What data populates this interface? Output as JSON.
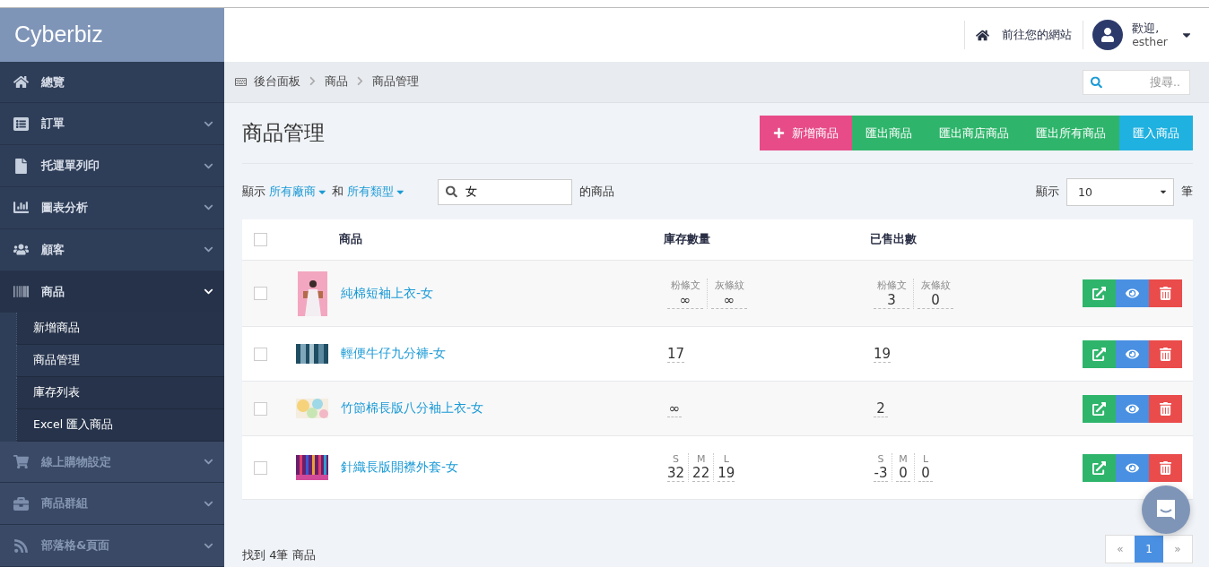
{
  "brand": {
    "logo": "Cyberbiz"
  },
  "topbar": {
    "site_link": "前往您的網站",
    "greeting": "歡迎,",
    "user": "esther"
  },
  "sidebar": {
    "items": [
      {
        "label": "總覽",
        "kind": "link",
        "expanded": false,
        "disabled": false
      },
      {
        "label": "訂單",
        "kind": "menu",
        "expanded": false,
        "disabled": false
      },
      {
        "label": "托運單列印",
        "kind": "menu",
        "expanded": false,
        "disabled": false
      },
      {
        "label": "圖表分析",
        "kind": "menu",
        "expanded": false,
        "disabled": false
      },
      {
        "label": "顧客",
        "kind": "menu",
        "expanded": false,
        "disabled": false
      },
      {
        "label": "商品",
        "kind": "menu",
        "expanded": true,
        "disabled": false,
        "children": [
          {
            "label": "新增商品",
            "selected": false
          },
          {
            "label": "商品管理",
            "selected": true
          },
          {
            "label": "庫存列表",
            "selected": false
          },
          {
            "label": "Excel 匯入商品",
            "selected": false
          }
        ]
      },
      {
        "label": "線上購物設定",
        "kind": "menu",
        "expanded": false,
        "disabled": true
      },
      {
        "label": "商品群組",
        "kind": "menu",
        "expanded": false,
        "disabled": true
      },
      {
        "label": "部落格&頁面",
        "kind": "menu",
        "expanded": false,
        "disabled": true
      }
    ]
  },
  "breadcrumb": [
    "後台面板",
    "商品",
    "商品管理"
  ],
  "search": {
    "placeholder": "搜尋.."
  },
  "page_title": "商品管理",
  "actions": [
    {
      "label": "新增商品",
      "kind": "add"
    },
    {
      "label": "匯出商品",
      "kind": "export"
    },
    {
      "label": "匯出商店商品",
      "kind": "export"
    },
    {
      "label": "匯出所有商品",
      "kind": "export"
    },
    {
      "label": "匯入商品",
      "kind": "import"
    }
  ],
  "filter": {
    "show": "顯示",
    "vendor": "所有廠商",
    "and": "和",
    "type": "所有類型",
    "query": "女",
    "suffix": "的商品"
  },
  "page_size": {
    "label": "顯示",
    "value": "10",
    "unit": "筆"
  },
  "table": {
    "all_checked": false,
    "columns": [
      "商品",
      "庫存數量",
      "已售出數"
    ],
    "rows": [
      {
        "checked": false,
        "name": "純棉短袖上衣-女",
        "stock": [
          {
            "label": "粉條文",
            "value": "∞"
          },
          {
            "label": "灰條紋",
            "value": "∞"
          }
        ],
        "sold": [
          {
            "label": "粉條文",
            "value": "3"
          },
          {
            "label": "灰條紋",
            "value": "0"
          }
        ]
      },
      {
        "checked": false,
        "name": "輕便牛仔九分褲-女",
        "stock": [
          {
            "value": "17"
          }
        ],
        "sold": [
          {
            "value": "19"
          }
        ]
      },
      {
        "checked": false,
        "name": "竹節棉長版八分袖上衣-女",
        "stock": [
          {
            "value": "∞"
          }
        ],
        "sold": [
          {
            "value": "2"
          }
        ]
      },
      {
        "checked": false,
        "name": "針織長版開襟外套-女",
        "stock": [
          {
            "label": "S",
            "value": "32"
          },
          {
            "label": "M",
            "value": "22"
          },
          {
            "label": "L",
            "value": "19"
          }
        ],
        "sold": [
          {
            "label": "S",
            "value": "-3"
          },
          {
            "label": "M",
            "value": "0"
          },
          {
            "label": "L",
            "value": "0"
          }
        ]
      }
    ]
  },
  "footer": {
    "found": "找到 4筆 商品"
  },
  "pagination": [
    {
      "label": "«",
      "selected": false
    },
    {
      "label": "1",
      "selected": true
    },
    {
      "label": "»",
      "selected": false
    }
  ]
}
